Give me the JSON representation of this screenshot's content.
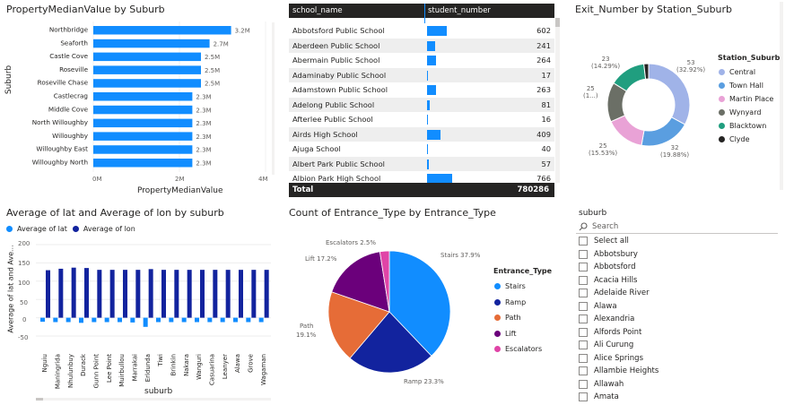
{
  "visual_prop": {
    "title": "PropertyMedianValue by Suburb",
    "ylabel": "Suburb",
    "xlabel": "PropertyMedianValue",
    "ticks": [
      "0M",
      "2M",
      "4M"
    ]
  },
  "visual_table": {
    "headers": [
      "school_name",
      "student_number"
    ],
    "rows": [
      {
        "name": "Abbotsford Public School",
        "value": "602",
        "n": 602
      },
      {
        "name": "Aberdeen Public School",
        "value": "241",
        "n": 241
      },
      {
        "name": "Abermain Public School",
        "value": "264",
        "n": 264
      },
      {
        "name": "Adaminaby Public School",
        "value": "17",
        "n": 17
      },
      {
        "name": "Adamstown Public School",
        "value": "263",
        "n": 263
      },
      {
        "name": "Adelong Public School",
        "value": "81",
        "n": 81
      },
      {
        "name": "Afterlee Public School",
        "value": "16",
        "n": 16
      },
      {
        "name": "Airds High School",
        "value": "409",
        "n": 409
      },
      {
        "name": "Ajuga School",
        "value": "40",
        "n": 40
      },
      {
        "name": "Albert Park Public School",
        "value": "57",
        "n": 57
      },
      {
        "name": "Albion Park High School",
        "value": "766",
        "n": 766
      }
    ],
    "total_label": "Total",
    "total_value": "780286"
  },
  "visual_donut": {
    "title": "Exit_Number by Station_Suburb",
    "legend_title": "Station_Suburb",
    "labels": [
      {
        "value": "53",
        "pct": "(32.92%)"
      },
      {
        "value": "32",
        "pct": "(19.88%)"
      },
      {
        "value": "25",
        "pct": "(15.53%)"
      },
      {
        "value": "25",
        "pct": "(1...)"
      },
      {
        "value": "23",
        "pct": "(14.29%)"
      }
    ]
  },
  "visual_latlon": {
    "title": "Average of lat and Average of lon by suburb",
    "legend": [
      "Average of lat",
      "Average of lon"
    ],
    "ylabel": "Average of lat and Ave...",
    "xlabel": "suburb",
    "yticks": [
      "200",
      "150",
      "100",
      "50",
      "0",
      "-50"
    ]
  },
  "visual_pie": {
    "title": "Count of Entrance_Type by Entrance_Type",
    "legend_title": "Entrance_Type",
    "labels": {
      "stairs": "Stairs 37.9%",
      "ramp": "Ramp 23.3%",
      "path_name": "Path",
      "path_pct": "19.1%",
      "lift": "Lift 17.2%",
      "escalators": "Escalators 2.5%"
    }
  },
  "slicer": {
    "title": "suburb",
    "search_placeholder": "Search",
    "items": [
      "Select all",
      "Abbotsbury",
      "Abbotsford",
      "Acacia Hills",
      "Adelaide River",
      "Alawa",
      "Alexandria",
      "Alfords Point",
      "Ali Curung",
      "Alice Springs",
      "Allambie Heights",
      "Allawah",
      "Amata"
    ]
  },
  "chart_data": [
    {
      "type": "bar",
      "orientation": "horizontal",
      "title": "PropertyMedianValue by Suburb",
      "xlabel": "PropertyMedianValue",
      "ylabel": "Suburb",
      "categories": [
        "Northbridge",
        "Seaforth",
        "Castle Cove",
        "Roseville",
        "Roseville Chase",
        "Castlecrag",
        "Middle Cove",
        "North Willoughby",
        "Willoughby",
        "Willoughby East",
        "Willoughby North"
      ],
      "values": [
        3.2,
        2.7,
        2.5,
        2.5,
        2.5,
        2.3,
        2.3,
        2.3,
        2.3,
        2.3,
        2.3
      ],
      "data_labels": [
        "3.2M",
        "2.7M",
        "2.5M",
        "2.5M",
        "2.5M",
        "2.3M",
        "2.3M",
        "2.3M",
        "2.3M",
        "2.3M",
        "2.3M"
      ],
      "xlim": [
        0,
        4
      ],
      "color": "#118dff"
    },
    {
      "type": "pie",
      "donut": true,
      "title": "Exit_Number by Station_Suburb",
      "legend_title": "Station_Suburb",
      "categories": [
        "Central",
        "Town Hall",
        "Martin Place",
        "Wynyard",
        "Blacktown",
        "Clyde"
      ],
      "values": [
        53,
        32,
        25,
        25,
        23,
        3
      ],
      "colors": [
        "#a0b3e8",
        "#5a9ee0",
        "#e9a2d6",
        "#6b6f66",
        "#209e7f",
        "#252423"
      ]
    },
    {
      "type": "bar",
      "title": "Average of lat and Average of lon by suburb",
      "xlabel": "suburb",
      "ylabel": "Average of lat and Ave...",
      "categories": [
        "Nguiu",
        "Maningrida",
        "Nhulunbuy",
        "Durack",
        "Gunn Point",
        "Lee Point",
        "Muirbullou",
        "Marrakai",
        "Erldunda",
        "Tiwi",
        "Brinkin",
        "Nakara",
        "Wanguri",
        "Casuarina",
        "Leanyer",
        "Alawa",
        "Grove",
        "Wagaman"
      ],
      "series": [
        {
          "name": "Average of lat",
          "values": [
            -11,
            -12,
            -12,
            -14,
            -12,
            -12,
            -12,
            -13,
            -25,
            -12,
            -12,
            -12,
            -12,
            -12,
            -12,
            -12,
            -12,
            -12
          ],
          "color": "#118dff"
        },
        {
          "name": "Average of lon",
          "values": [
            130,
            134,
            137,
            136,
            131,
            131,
            131,
            131,
            133,
            131,
            131,
            131,
            131,
            131,
            131,
            131,
            131,
            131
          ],
          "color": "#12239e"
        }
      ],
      "ylim": [
        -50,
        200
      ]
    },
    {
      "type": "pie",
      "title": "Count of Entrance_Type by Entrance_Type",
      "legend_title": "Entrance_Type",
      "categories": [
        "Stairs",
        "Ramp",
        "Path",
        "Lift",
        "Escalators"
      ],
      "values": [
        37.9,
        23.3,
        19.1,
        17.2,
        2.5
      ],
      "colors": [
        "#118dff",
        "#12239e",
        "#e66c37",
        "#6b007b",
        "#e044a7"
      ]
    }
  ]
}
